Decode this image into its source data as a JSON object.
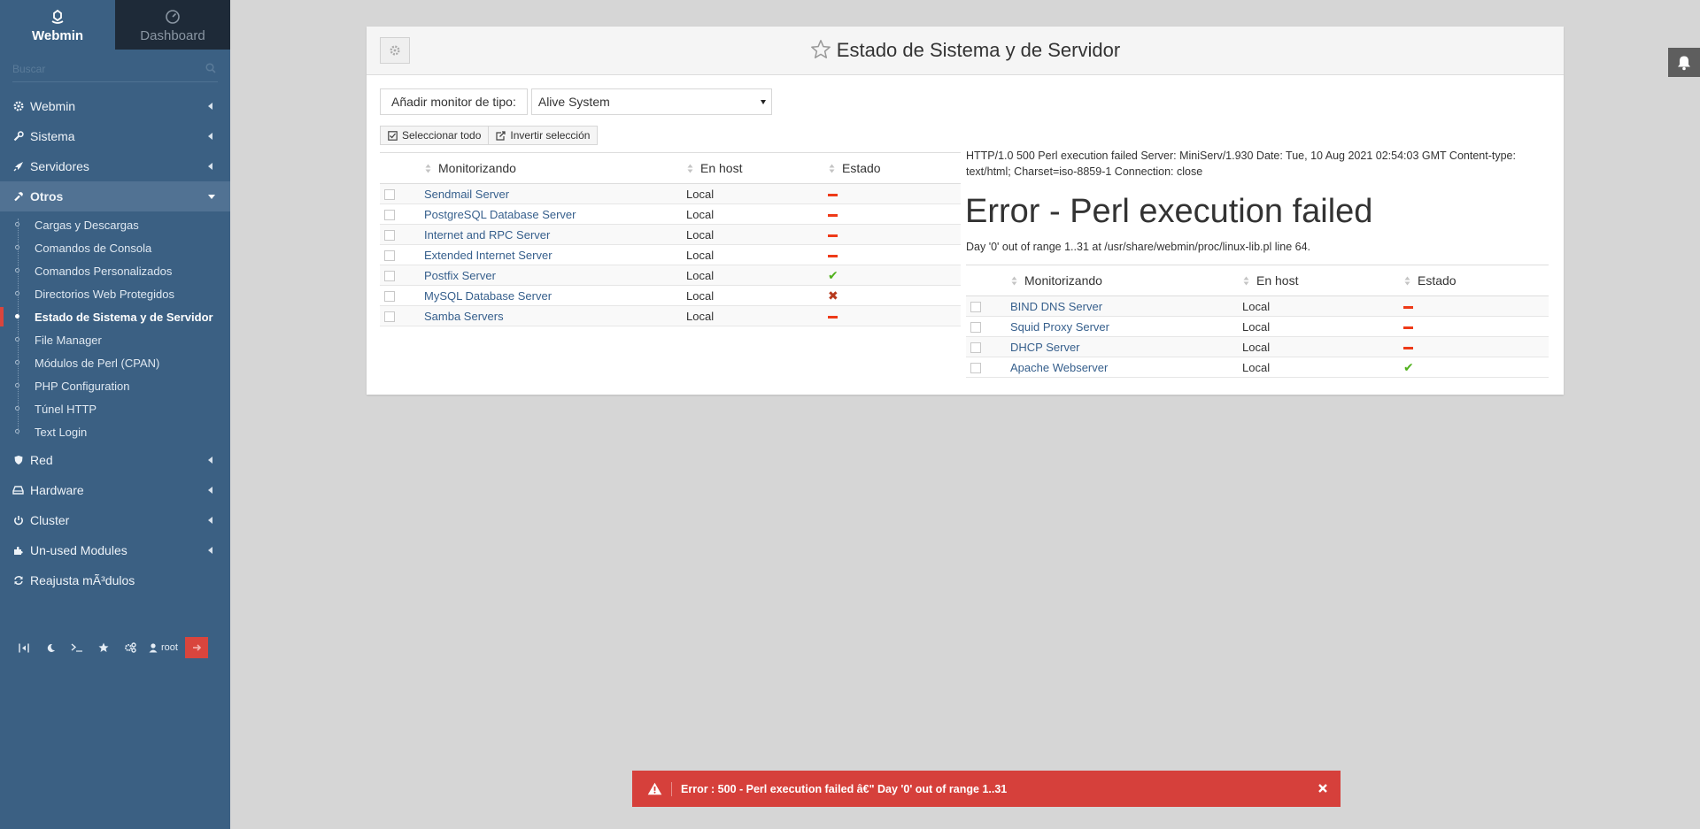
{
  "sidebar": {
    "brand_tabs": [
      {
        "label": "Webmin",
        "icon": "webmin-logo-icon",
        "active": true
      },
      {
        "label": "Dashboard",
        "icon": "dashboard-gauge-icon",
        "active": false
      }
    ],
    "search_placeholder": "Buscar",
    "menu": [
      {
        "label": "Webmin",
        "icon": "gear-icon"
      },
      {
        "label": "Sistema",
        "icon": "wrench-icon"
      },
      {
        "label": "Servidores",
        "icon": "rocket-icon"
      },
      {
        "label": "Otros",
        "icon": "hammer-icon",
        "open": true
      }
    ],
    "submenu": [
      "Cargas y Descargas",
      "Comandos de Consola",
      "Comandos Personalizados",
      "Directorios Web Protegidos",
      "Estado de Sistema y de Servidor",
      "File Manager",
      "Módulos de Perl (CPAN)",
      "PHP Configuration",
      "Túnel HTTP",
      "Text Login"
    ],
    "submenu_active": "Estado de Sistema y de Servidor",
    "menu_after": [
      {
        "label": "Red",
        "icon": "shield-icon"
      },
      {
        "label": "Hardware",
        "icon": "hard-drive-icon"
      },
      {
        "label": "Cluster",
        "icon": "power-icon"
      },
      {
        "label": "Un-used Modules",
        "icon": "puzzle-icon"
      },
      {
        "label": "Reajusta mÃ³dulos",
        "icon": "refresh-icon"
      }
    ],
    "toolbar": {
      "user_label": "root"
    }
  },
  "page": {
    "title": "Estado de Sistema y de Servidor",
    "add_monitor_label": "Añadir monitor de tipo:",
    "add_monitor_selected": "Alive System",
    "select_all_label": "Seleccionar todo",
    "invert_label": "Invertir selección",
    "col_monitoring": "Monitorizando",
    "col_host": "En host",
    "col_status": "Estado",
    "left_rows": [
      {
        "name": "Sendmail Server",
        "host": "Local",
        "status": "minus"
      },
      {
        "name": "PostgreSQL Database Server",
        "host": "Local",
        "status": "minus"
      },
      {
        "name": "Internet and RPC Server",
        "host": "Local",
        "status": "minus"
      },
      {
        "name": "Extended Internet Server",
        "host": "Local",
        "status": "minus"
      },
      {
        "name": "Postfix Server",
        "host": "Local",
        "status": "ok"
      },
      {
        "name": "MySQL Database Server",
        "host": "Local",
        "status": "error"
      },
      {
        "name": "Samba Servers",
        "host": "Local",
        "status": "minus"
      }
    ],
    "error_header": "HTTP/1.0 500 Perl execution failed Server: MiniServ/1.930 Date: Tue, 10 Aug 2021 02:54:03 GMT Content-type: text/html; Charset=iso-8859-1 Connection: close",
    "error_title": "Error - Perl execution failed",
    "error_detail": "Day '0' out of range 1..31 at /usr/share/webmin/proc/linux-lib.pl line 64.",
    "right_rows": [
      {
        "name": "BIND DNS Server",
        "host": "Local",
        "status": "minus"
      },
      {
        "name": "Squid Proxy Server",
        "host": "Local",
        "status": "minus"
      },
      {
        "name": "DHCP Server",
        "host": "Local",
        "status": "minus"
      },
      {
        "name": "Apache Webserver",
        "host": "Local",
        "status": "ok"
      }
    ]
  },
  "toast": {
    "message": "Error :  500 - Perl execution failed â€\" Day '0' out of range 1..31"
  },
  "colors": {
    "sidebar_bg": "#3b6083",
    "sidebar_dark": "#1e2a38",
    "accent_red": "#d6403b",
    "status_minus": "#ee3a18",
    "status_ok": "#50b11c",
    "status_error": "#b7391d",
    "link": "#365f8c"
  }
}
